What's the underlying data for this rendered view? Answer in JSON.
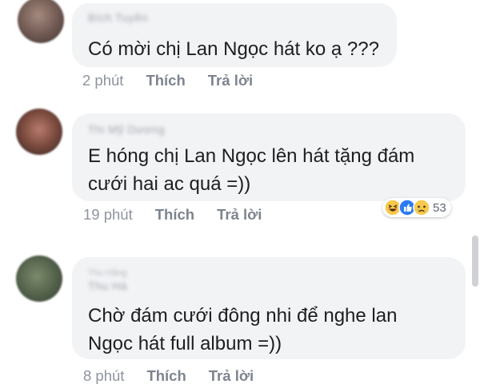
{
  "comments": [
    {
      "author": "Bích Tuyền",
      "text": "Có mời chị Lan Ngọc hát ko ạ ???",
      "time": "2 phút",
      "like": "Thích",
      "reply": "Trả lời"
    },
    {
      "author": "Thi Mỹ Dương",
      "text": "E hóng chị Lan Ngọc lên hát tặng đám\ncưới hai ac quá =))",
      "time": "19 phút",
      "like": "Thích",
      "reply": "Trả lời",
      "reactions": {
        "icons": [
          "haha-icon",
          "like-icon",
          "sad-icon"
        ],
        "count": "53"
      }
    },
    {
      "author": "Thu Hà",
      "author_sub": "Thu Hằng",
      "text": "Chờ đám cưới đông nhi để nghe lan\nNgọc hát full album =))",
      "time": "8 phút",
      "like": "Thích",
      "reply": "Trả lời"
    }
  ],
  "colors": {
    "bubble": "#f2f3f5",
    "text": "#1c1e21",
    "meta": "#8d949e"
  }
}
